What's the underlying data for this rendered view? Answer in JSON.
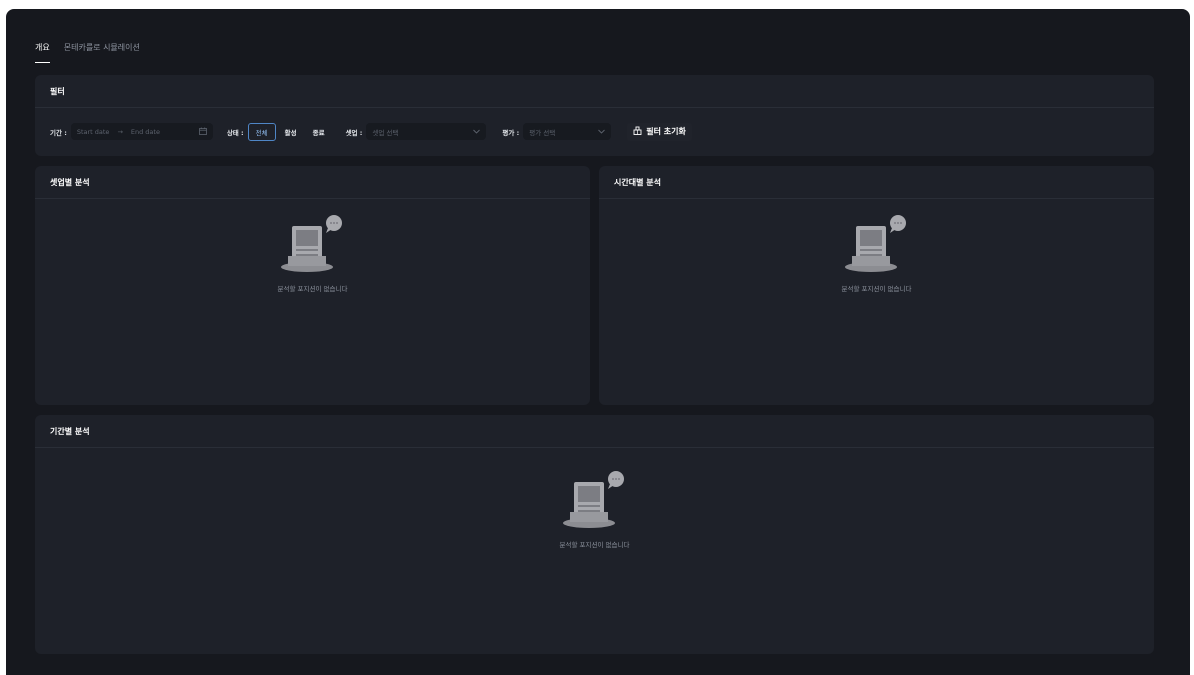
{
  "tabs": [
    {
      "label": "개요",
      "active": true
    },
    {
      "label": "몬테카를로 시뮬레이션",
      "active": false
    }
  ],
  "filter": {
    "title": "필터",
    "period_label": "기간 :",
    "start_placeholder": "Start date",
    "arrow": "→",
    "end_placeholder": "End date",
    "status_label": "상태 :",
    "status_options": [
      "전체",
      "활성",
      "종료"
    ],
    "status_selected": "전체",
    "setup_label": "셋업 :",
    "setup_placeholder": "셋업 선택",
    "rating_label": "평가 :",
    "rating_placeholder": "평가 선택",
    "reset_label": "필터 초기화"
  },
  "panels": {
    "setup": {
      "title": "셋업별 분석",
      "empty": "분석할 포지션이 없습니다"
    },
    "time": {
      "title": "시간대별 분석",
      "empty": "분석할 포지션이 없습니다"
    },
    "period": {
      "title": "기간별 분석",
      "empty": "분석할 포지션이 없습니다"
    }
  },
  "colors": {
    "window_bg": "#16181e",
    "panel_bg": "#1e2129",
    "accent": "#4f86c6"
  },
  "icons": [
    "calendar-icon",
    "chevron-down-icon",
    "reset-icon",
    "empty-inbox-icon"
  ]
}
